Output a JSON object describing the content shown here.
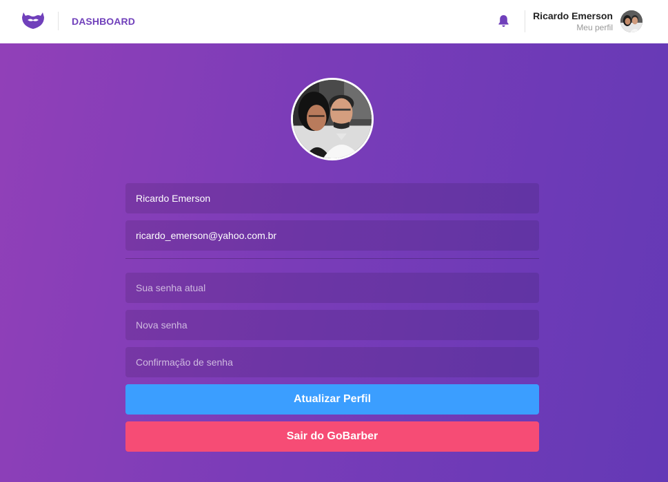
{
  "header": {
    "nav_label": "DASHBOARD",
    "profile": {
      "name": "Ricardo Emerson",
      "link_label": "Meu perfil"
    }
  },
  "icons": {
    "logo": "mustache-logo-icon",
    "notifications": "bell-icon"
  },
  "form": {
    "name_value": "Ricardo Emerson",
    "email_value": "ricardo_emerson@yahoo.com.br",
    "old_password_placeholder": "Sua senha atual",
    "new_password_placeholder": "Nova senha",
    "confirm_password_placeholder": "Confirmação de senha",
    "update_button_label": "Atualizar Perfil",
    "logout_button_label": "Sair do GoBarber"
  },
  "colors": {
    "brand": "#7040bb",
    "update_button": "#3b9eff",
    "logout_button": "#f64c75",
    "background_start": "#9240b8",
    "background_end": "#6439b6"
  }
}
